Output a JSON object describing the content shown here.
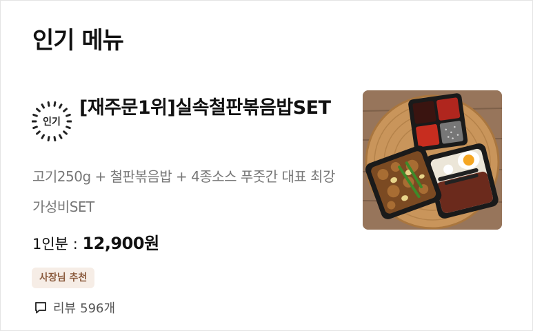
{
  "section": {
    "title": "인기 메뉴"
  },
  "menu": {
    "popular_badge": "인기",
    "name": "[재주문1위]실속철판볶음밥SET",
    "description": "고기250g + 철판볶음밥 + 4종소스 푸줏간 대표 최강 가성비SET",
    "portion": "1인분",
    "price_separator": " : ",
    "price": "12,900원",
    "owner_badge": "사장님 추천",
    "review_label": "리뷰",
    "review_count": "596개",
    "image_icon": "food-photo"
  },
  "colors": {
    "accent_badge_bg": "#f6ede6",
    "accent_badge_text": "#8a5a3c",
    "description_text": "#777777"
  }
}
